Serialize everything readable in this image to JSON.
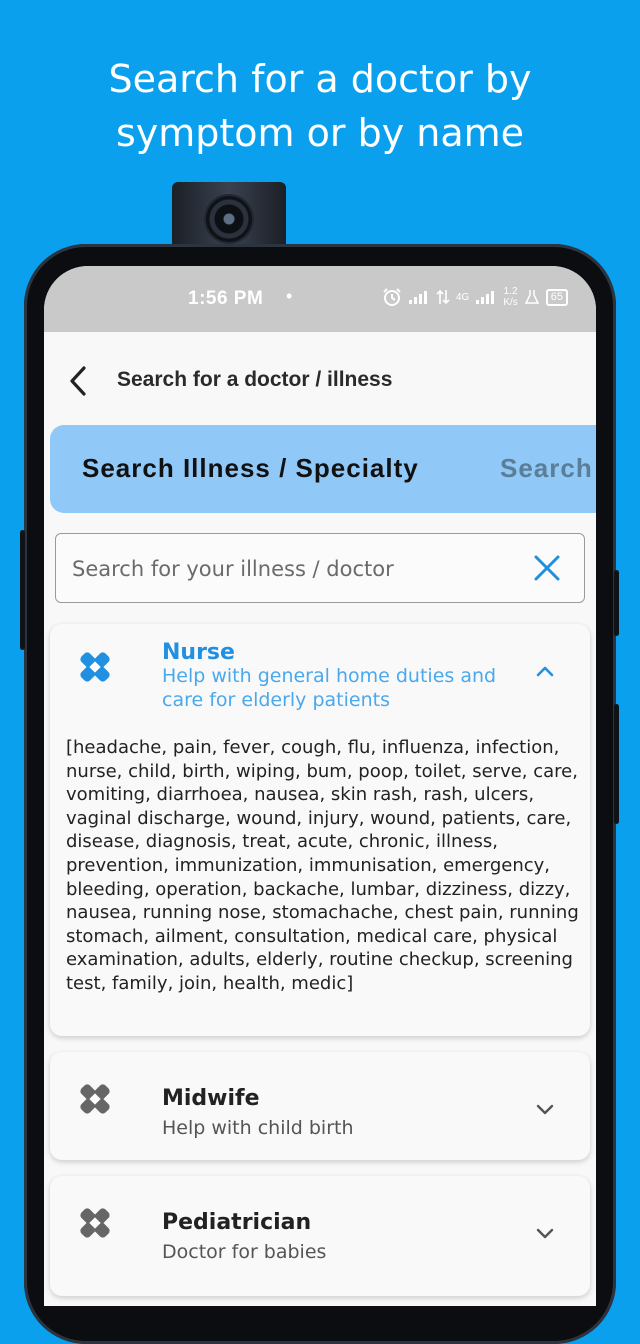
{
  "headline": {
    "line1": "Search for a doctor by",
    "line2": "symptom or by name"
  },
  "status_bar": {
    "time": "1:56 PM",
    "dot": "•",
    "speed_top": "1.2",
    "speed_bottom": "K/s",
    "network": "4G",
    "battery": "65"
  },
  "appbar": {
    "title": "Search for a doctor / illness"
  },
  "tabs": [
    {
      "label": "Search Illness / Specialty",
      "active": true
    },
    {
      "label": "Search",
      "active": false
    }
  ],
  "search": {
    "placeholder": "Search for your illness / doctor",
    "value": ""
  },
  "results": [
    {
      "name": "Nurse",
      "description": "Help with general home duties and care for elderly patients",
      "expanded": true,
      "keywords": "[headache, pain, fever, cough, flu, influenza, infection, nurse, child, birth, wiping, bum, poop, toilet, serve, care, vomiting, diarrhoea, nausea, skin rash, rash, ulcers, vaginal discharge, wound, injury, wound, patients, care, disease, diagnosis, treat, acute, chronic, illness, prevention, immunization, immunisation, emergency, bleeding, operation, backache, lumbar, dizziness, dizzy, nausea, running nose, stomachache, chest pain, running stomach, ailment, consultation, medical care, physical examination, adults, elderly, routine checkup, screening test, family, join, health, medic]"
    },
    {
      "name": "Midwife",
      "description": "Help with child birth",
      "expanded": false
    },
    {
      "name": "Pediatrician",
      "description": "Doctor for babies",
      "expanded": false
    }
  ],
  "colors": {
    "background": "#0aa0ee",
    "accent": "#2190e0",
    "tab_bg": "#90c8f8",
    "icon_grey": "#666666"
  },
  "icons": {
    "back": "arrow-left-icon",
    "clear": "close-icon",
    "specialty": "bandage-icon",
    "expand": "chevron-up-icon",
    "collapse": "chevron-down-icon"
  }
}
